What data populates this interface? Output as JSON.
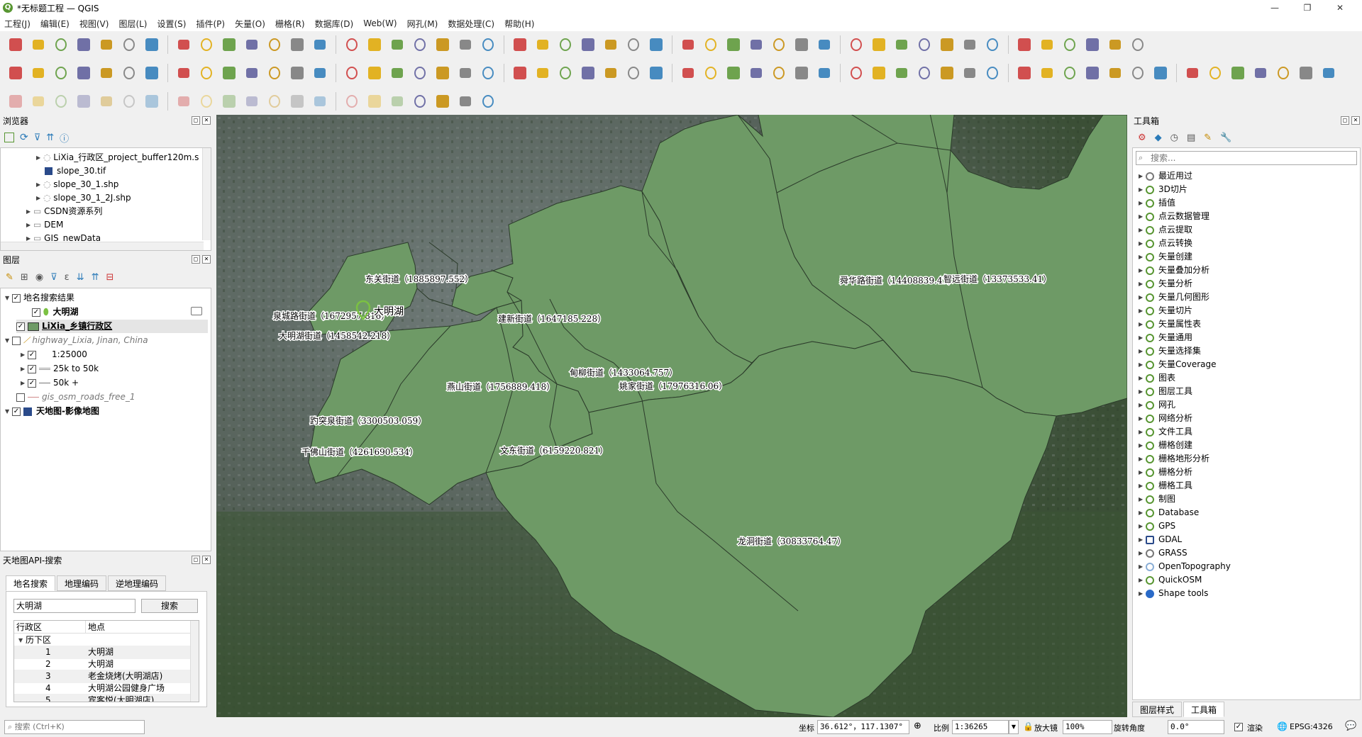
{
  "window": {
    "title": "*无标题工程 — QGIS",
    "minimize": "—",
    "restore": "❐",
    "close": "✕"
  },
  "menu": [
    "工程(J)",
    "编辑(E)",
    "视图(V)",
    "图层(L)",
    "设置(S)",
    "插件(P)",
    "矢量(O)",
    "栅格(R)",
    "数据库(D)",
    "Web(W)",
    "网孔(M)",
    "数据处理(C)",
    "帮助(H)"
  ],
  "browser": {
    "title": "浏览器",
    "items": [
      "LiXia_行政区_project_buffer120m.s",
      "slope_30.tif",
      "slope_30_1.shp",
      "slope_30_1_2J.shp",
      "CSDN资源系列",
      "DEM",
      "GIS_newData"
    ]
  },
  "layers": {
    "title": "图层",
    "items": [
      "地名搜索结果",
      "大明湖",
      "LiXia_乡镇行政区",
      "highway_Lixia, Jinan, China",
      "1:25000",
      "25k to 50k",
      "50k +",
      "gis_osm_roads_free_1",
      "天地图-影像地图"
    ]
  },
  "tianditu": {
    "title": "天地图API-搜索",
    "tabs": [
      "地名搜索",
      "地理编码",
      "逆地理编码"
    ],
    "query": "大明湖",
    "search_btn": "搜索",
    "col1": "行政区",
    "col2": "地点",
    "group": "历下区",
    "results": [
      {
        "n": "1",
        "place": "大明湖"
      },
      {
        "n": "2",
        "place": "大明湖"
      },
      {
        "n": "3",
        "place": "老金烧烤(大明湖店)"
      },
      {
        "n": "4",
        "place": "大明湖公园健身广场"
      },
      {
        "n": "5",
        "place": "宾客悦(大明湖店)"
      }
    ]
  },
  "toolbox": {
    "title": "工具箱",
    "search_placeholder": "搜索...",
    "items": [
      "最近用过",
      "3D切片",
      "插值",
      "点云数据管理",
      "点云提取",
      "点云转换",
      "矢量创建",
      "矢量叠加分析",
      "矢量分析",
      "矢量几何图形",
      "矢量切片",
      "矢量属性表",
      "矢量通用",
      "矢量选择集",
      "矢量Coverage",
      "图表",
      "图层工具",
      "网孔",
      "网络分析",
      "文件工具",
      "栅格创建",
      "栅格地形分析",
      "栅格分析",
      "栅格工具",
      "制图",
      "Database",
      "GPS",
      "GDAL",
      "GRASS",
      "OpenTopography",
      "QuickOSM",
      "Shape tools"
    ],
    "tabs": [
      "图层样式",
      "工具箱"
    ]
  },
  "map": {
    "marker_label": "大明湖",
    "labels": [
      "东关街道（1885897.552）",
      "泉城路街道（1672957.816）",
      "大明湖街道（1458542.218）",
      "建新街道（1647185.228）",
      "舜华路街道（14408839.47）",
      "智远街道（13373533.41）",
      "甸柳街道（1433064.757）",
      "姚家街道（17976316.06）",
      "燕山街道（1756889.418）",
      "趵突泉街道（3300503.059）",
      "千佛山街道（4261690.534）",
      "文东街道（6159220.821）",
      "龙洞街道（30833764.47）"
    ],
    "polygon_fill": "#6e9a66"
  },
  "status": {
    "locate_placeholder": "搜索 (Ctrl+K)",
    "coord_label": "坐标",
    "coord": "36.612°，117.1307°",
    "scale_label": "比例",
    "scale": "1:36265",
    "mag_label": "放大镜",
    "mag": "100%",
    "rot_label": "旋转角度",
    "rot": "0.0°",
    "render": "渲染",
    "crs": "EPSG:4326"
  }
}
